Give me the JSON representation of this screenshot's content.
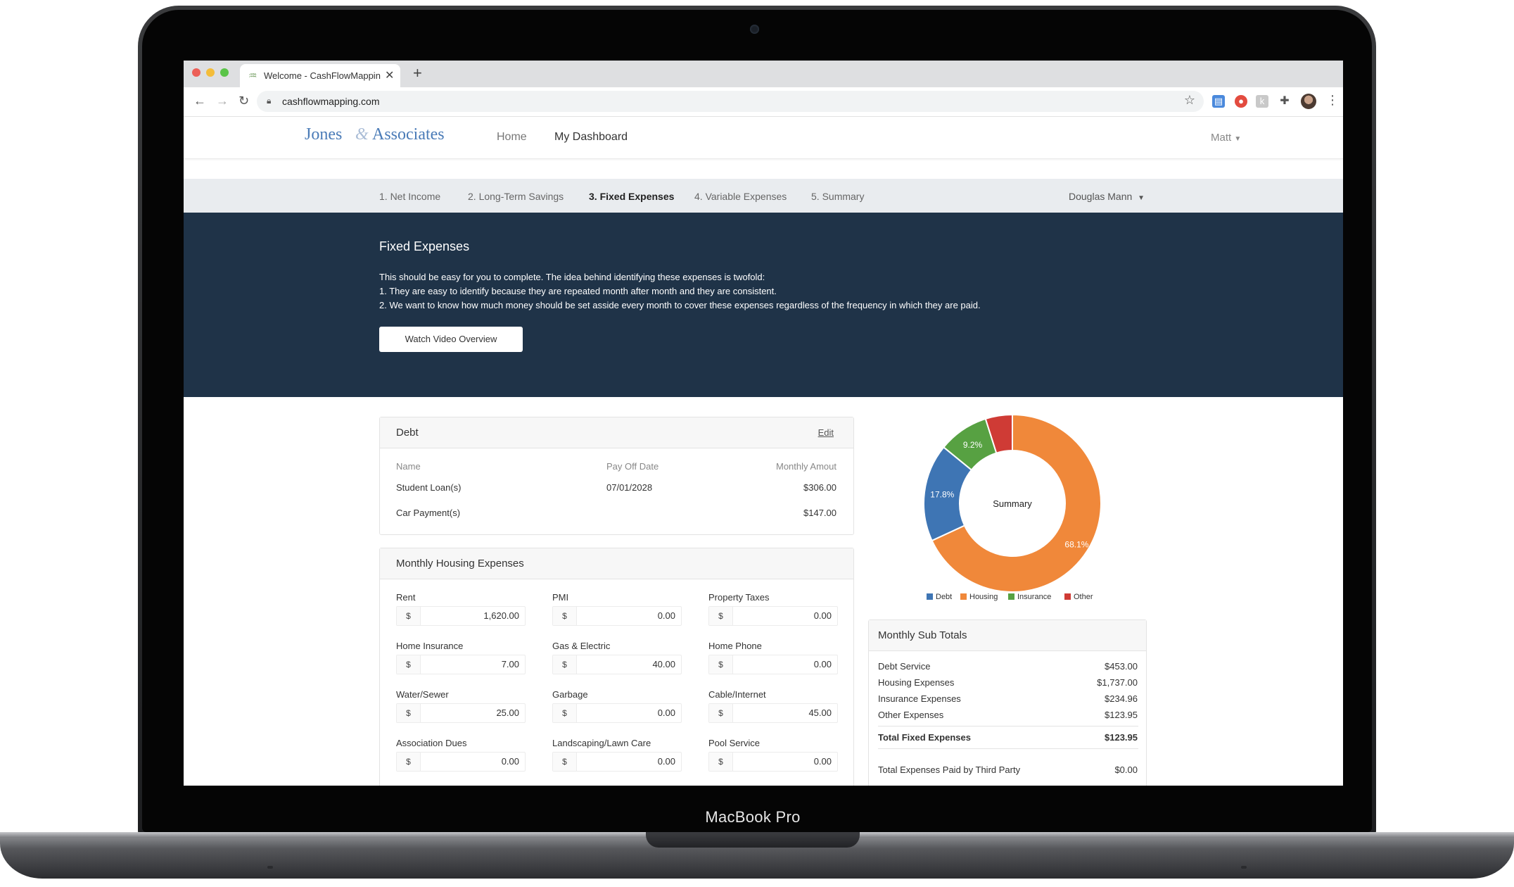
{
  "device": {
    "label": "MacBook Pro"
  },
  "browser": {
    "tab_title": "Welcome - CashFlowMapping.",
    "new_tab": "+",
    "tab_close": "✕",
    "url": "cashflowmapping.com"
  },
  "site": {
    "logo_left": "Jones",
    "logo_amp": "&",
    "logo_right": "Associates",
    "nav": {
      "home": "Home",
      "dashboard": "My Dashboard"
    },
    "user": "Matt"
  },
  "steps": {
    "items": [
      "1. Net Income",
      "2. Long-Term Savings",
      "3. Fixed Expenses",
      "4. Variable Expenses",
      "5. Summary"
    ],
    "active_index": 2,
    "client": "Douglas Mann"
  },
  "hero": {
    "title": "Fixed Expenses",
    "lines": [
      "This should be easy for you to complete. The idea behind identifying these expenses is twofold:",
      "1. They are easy to identify because they are repeated month after month and they are consistent.",
      "2. We want to know how much money should be set asside every month to cover these expenses regardless of the frequency in which they  are paid."
    ],
    "button": "Watch Video Overview"
  },
  "debt": {
    "title": "Debt",
    "edit": "Edit",
    "columns": [
      "Name",
      "Pay Off Date",
      "Monthly Amout"
    ],
    "rows": [
      {
        "name": "Student Loan(s)",
        "date": "07/01/2028",
        "amount": "$306.00"
      },
      {
        "name": "Car Payment(s)",
        "date": "",
        "amount": "$147.00"
      }
    ]
  },
  "housing": {
    "title": "Monthly Housing Expenses",
    "currency": "$",
    "fields": [
      {
        "label": "Rent",
        "value": "1,620.00"
      },
      {
        "label": "PMI",
        "value": "0.00"
      },
      {
        "label": "Property Taxes",
        "value": "0.00"
      },
      {
        "label": "Home Insurance",
        "value": "7.00"
      },
      {
        "label": "Gas & Electric",
        "value": "40.00"
      },
      {
        "label": "Home Phone",
        "value": "0.00"
      },
      {
        "label": "Water/Sewer",
        "value": "25.00"
      },
      {
        "label": "Garbage",
        "value": "0.00"
      },
      {
        "label": "Cable/Internet",
        "value": "45.00"
      },
      {
        "label": "Association Dues",
        "value": "0.00"
      },
      {
        "label": "Landscaping/Lawn Care",
        "value": "0.00"
      },
      {
        "label": "Pool Service",
        "value": "0.00"
      }
    ]
  },
  "chart_data": {
    "type": "pie",
    "title": "Summary",
    "donut": true,
    "categories": [
      "Debt",
      "Housing",
      "Insurance",
      "Other"
    ],
    "values": [
      17.8,
      68.1,
      9.2,
      4.9
    ],
    "labels": [
      "17.8%",
      "68.1%",
      "9.2%",
      ""
    ],
    "colors": [
      "#3e75b4",
      "#f0883a",
      "#57a142",
      "#cf3b35"
    ],
    "legend": "bottom"
  },
  "subtotals": {
    "title": "Monthly Sub Totals",
    "rows": [
      {
        "label": "Debt Service",
        "value": "$453.00"
      },
      {
        "label": "Housing Expenses",
        "value": "$1,737.00"
      },
      {
        "label": "Insurance Expenses",
        "value": "$234.96"
      },
      {
        "label": "Other Expenses",
        "value": "$123.95"
      }
    ],
    "total": {
      "label": "Total Fixed Expenses",
      "value": "$123.95"
    },
    "third_party": {
      "label": "Total Expenses Paid by Third Party",
      "value": "$0.00"
    }
  }
}
